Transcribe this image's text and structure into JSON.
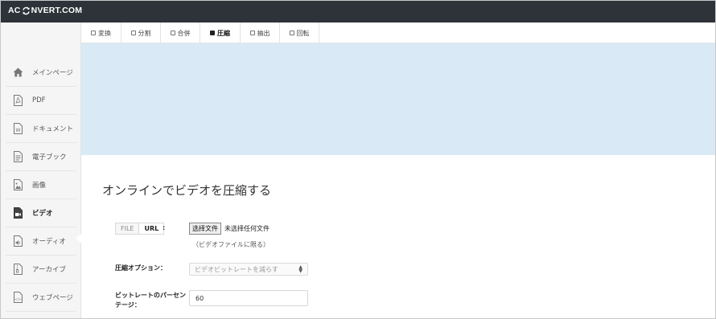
{
  "header": {
    "logo_left": "AC",
    "logo_right": "NVERT.COM"
  },
  "sidebar": {
    "items": [
      {
        "label": "メインページ",
        "icon": "home-icon"
      },
      {
        "label": "PDF",
        "icon": "pdf-file-icon"
      },
      {
        "label": "ドキュメント",
        "icon": "word-doc-icon"
      },
      {
        "label": "電子ブック",
        "icon": "ebook-icon"
      },
      {
        "label": "画像",
        "icon": "image-file-icon"
      },
      {
        "label": "ビデオ",
        "icon": "video-file-icon",
        "active": true
      },
      {
        "label": "オーディオ",
        "icon": "audio-file-icon"
      },
      {
        "label": "アーカイブ",
        "icon": "archive-file-icon"
      },
      {
        "label": "ウェブページ",
        "icon": "code-file-icon"
      }
    ]
  },
  "tabs": [
    {
      "label": "変換"
    },
    {
      "label": "分割"
    },
    {
      "label": "合併"
    },
    {
      "label": "圧縮",
      "active": true
    },
    {
      "label": "抽出"
    },
    {
      "label": "回転"
    }
  ],
  "main": {
    "title": "オンラインでビデオを圧縮する",
    "source_toggle": {
      "file": "FILE",
      "url": "URL",
      "colon": ":"
    },
    "file_button": "选择文件",
    "file_status": "未选择任何文件",
    "file_hint": "（ビデオファイルに限る）",
    "compress_label": "圧縮オプション：",
    "compress_selected": "ビデオビットレートを減らす",
    "bitrate_label_line1": "ビットレートのパーセン",
    "bitrate_label_line2": "テージ：",
    "bitrate_value": "60"
  },
  "colors": {
    "topbar": "#2d3338",
    "banner": "#d9eaf6",
    "sidebar": "#f5f5f5"
  }
}
